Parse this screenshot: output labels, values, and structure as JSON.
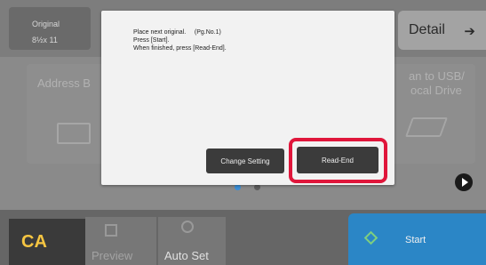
{
  "header": {
    "original_label": "Original",
    "paper_size": "8½x 11",
    "detail_label": "Detail",
    "detail_arrow": "➔"
  },
  "background_tiles": {
    "left_label": "Address B",
    "right_label_line1": "an to USB/",
    "right_label_line2": "ocal Drive"
  },
  "pager": {
    "active_index": 0,
    "total": 2
  },
  "dialog": {
    "line1_text": "Place next original.",
    "line1_page": "(Pg.No.1)",
    "line2": "Press [Start].",
    "line3": "When finished, press [Read-End].",
    "change_setting_label": "Change Setting",
    "read_end_label": "Read-End"
  },
  "bottom_bar": {
    "ca_label": "CA",
    "preview_label": "Preview",
    "auto_set_label": "Auto Set",
    "start_label": "Start"
  },
  "colors": {
    "highlight": "#e0163b",
    "start_button": "#2b86c6",
    "ca_text": "#f5c542",
    "pager_active": "#3a8fd8"
  },
  "icons": [
    "arrow-right-icon",
    "address-book-icon",
    "usb-icon",
    "play-icon",
    "preview-icon",
    "auto-set-icon",
    "start-icon"
  ]
}
